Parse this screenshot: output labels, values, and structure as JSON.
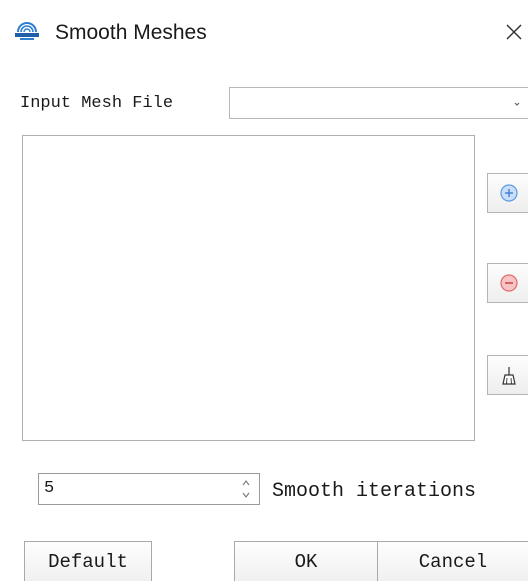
{
  "window": {
    "title": "Smooth Meshes",
    "icon": "app-logo-icon",
    "close_icon": "close-icon"
  },
  "input_file": {
    "label": "Input Mesh File",
    "value": "",
    "dropdown_icon": "chevron-down-icon"
  },
  "file_list": {
    "items": []
  },
  "side_buttons": {
    "add_icon": "plus-circle-icon",
    "remove_icon": "minus-circle-icon",
    "clear_icon": "broom-icon"
  },
  "iterations": {
    "value": "5",
    "label": "Smooth iterations"
  },
  "buttons": {
    "default_label": "Default",
    "ok_label": "OK",
    "cancel_label": "Cancel"
  },
  "colors": {
    "add_accent": "#5b9be0",
    "remove_accent": "#e06a6a"
  }
}
